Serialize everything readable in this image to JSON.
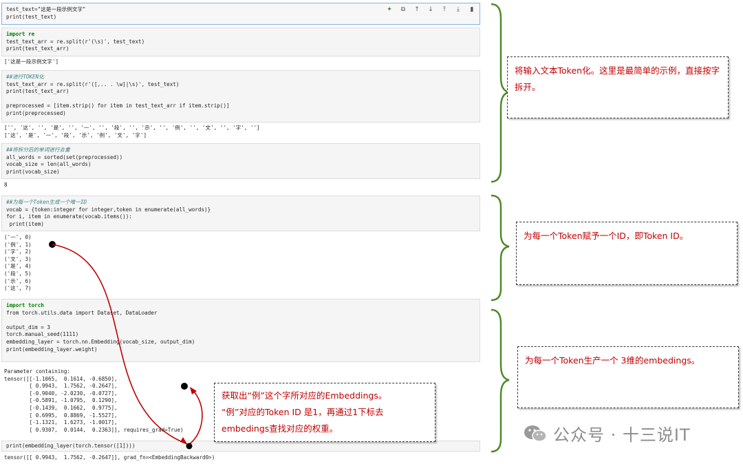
{
  "notebook": {
    "cell1": {
      "code": [
        "test_text=\"这是一段示例文字\"",
        "print(test_text)"
      ],
      "toolbar_icons": [
        "sparkle-icon",
        "copy-icon",
        "move-up-icon",
        "move-down-icon",
        "insert-above-icon",
        "insert-below-icon",
        "delete-icon"
      ]
    },
    "cell2": {
      "code": [
        "import re",
        "test_text_arr = re.split(r'(\\s)', test_text)",
        "print(test_text_arr)"
      ],
      "output": [
        "['这是一段示例文字']"
      ]
    },
    "cell3": {
      "code": [
        "##进行TOKEN化",
        "test_text_arr = re.split(r'([,.. . \\w]|\\s)', test_text)",
        "print(test_text_arr)",
        "",
        "preprocessed = [item.strip() for item in test_text_arr if item.strip()]",
        "print(preprocessed)"
      ],
      "output": [
        "['', '这', '', '是', '', '一', '', '段', '', '示', '', '例', '', '文', '', '字', '']",
        "['这', '是', '一', '段', '示', '例', '文', '字']"
      ]
    },
    "cell4": {
      "code": [
        "##将拆分后的单词进行去重",
        "all_words = sorted(set(preprocessed))",
        "vocab_size = len(all_words)",
        "print(vocab_size)"
      ],
      "output": [
        "8"
      ]
    },
    "cell5": {
      "code": [
        "##为每一个Token生成一个唯一ID",
        "vocab = {token:integer for integer,token in enumerate(all_words)}",
        "for i, item in enumerate(vocab.items()):",
        " print(item)"
      ],
      "output": [
        "('一', 0)",
        "('例', 1)",
        "('字', 2)",
        "('文', 3)",
        "('是', 4)",
        "('段', 5)",
        "('示', 6)",
        "('这', 7)"
      ]
    },
    "cell6": {
      "code": [
        "import torch",
        "from torch.utils.data import Dataset, DataLoader",
        "",
        "output_dim = 3",
        "torch.manual_seed(1111)",
        "embedding_layer = torch.nn.Embedding(vocab_size, output_dim)",
        "print(embedding_layer.weight)"
      ],
      "output": [
        "Parameter containing:",
        "tensor([[-1.1065,  0.1614, -0.6850],",
        "        [ 0.9943,  1.7562, -0.2647],",
        "        [-0.9040, -2.0230, -0.0727],",
        "        [-0.5891, -1.0795,  0.1290],",
        "        [-0.1439,  0.1662,  0.9775],",
        "        [ 0.6995,  0.8869, -1.5527],",
        "        [-1.1321,  1.6273, -1.0017],",
        "        [ 0.9307,  0.0144,  0.2363]], requires_grad=True)"
      ]
    },
    "cell7": {
      "code": [
        "print(embedding_layer(torch.tensor([1])))"
      ],
      "output": [
        "tensor([[ 0.9943,  1.7562, -0.2647]], grad_fn=<EmbeddingBackward0>)"
      ]
    }
  },
  "annotations": {
    "note1": "将输入文本Token化。这里是最简单的示例，直接按字拆开。",
    "note2": "为每一个Token赋予一个ID，即Token ID。",
    "note3": "为每一个Token生产一个 3维的embedings。",
    "note4": [
      "获取出“例”这个字所对应的Embeddings。",
      "“例”对应的Token ID 是1，再通过1下标去",
      "embedings查找对应的权重。"
    ]
  },
  "watermark": {
    "text": "公众号 · 十三说IT",
    "icon": "wechat-icon"
  },
  "colors": {
    "brace": "#4d8a2a",
    "arrow": "#c00000",
    "note_text": "#c00000",
    "cell_bg": "#f5f5f5",
    "active_border": "#7fb3e6"
  }
}
